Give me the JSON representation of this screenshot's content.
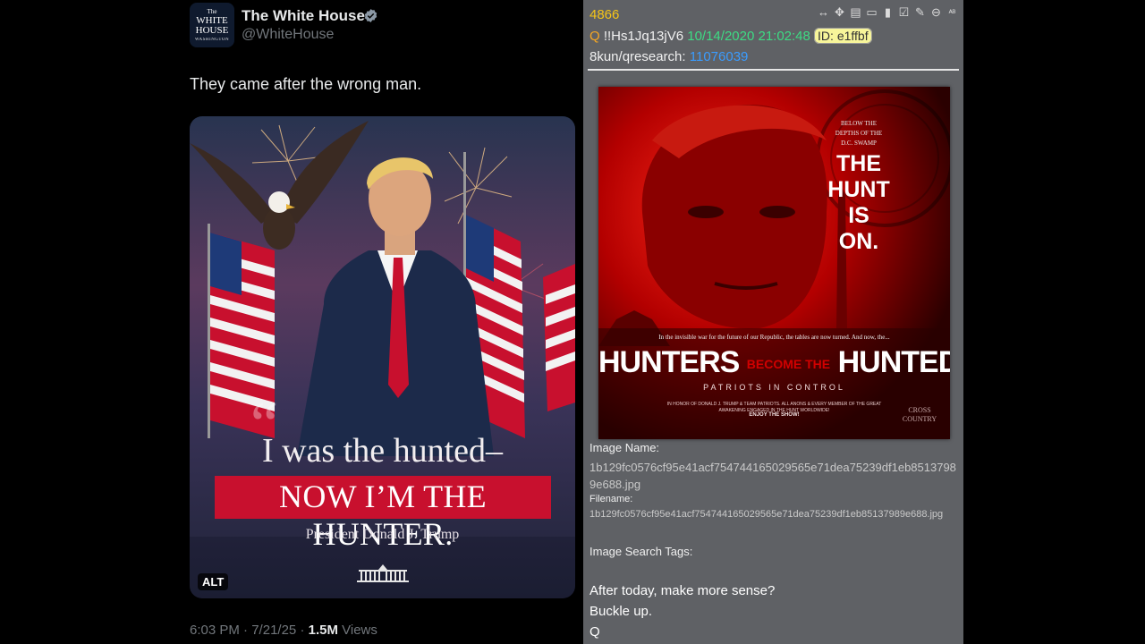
{
  "tweet": {
    "avatar_text": [
      "The",
      "WHITE\nHOUSE",
      "WASHINGTON"
    ],
    "display_name": "The White House",
    "handle": "@WhiteHouse",
    "verified": true,
    "text": "They came after the wrong man.",
    "media": {
      "quote_line1": "I was the hunted–",
      "quote_line2": "NOW I’M THE HUNTER.",
      "attribution": "President Donald J. Trump",
      "alt_label": "ALT",
      "banner_color": "#c8102e"
    },
    "meta": {
      "time": "6:03 PM",
      "date": "7/21/25",
      "views_count": "1.5M",
      "views_label": "Views"
    }
  },
  "post": {
    "number": "4866",
    "toolbar_icons": [
      "expand-icon",
      "move-icon",
      "file-icon",
      "vr-icon",
      "clipboard-icon",
      "clipboard-check-icon",
      "pin-icon",
      "arrow-up-icon",
      "translate-icon"
    ],
    "q": "Q",
    "tripcode": "!!Hs1Jq13jV6",
    "datetime": "10/14/2020 21:02:48",
    "id": "ID: e1ffbf",
    "board": "8kun/qresearch:",
    "thread_id": "11076039",
    "image": {
      "below_text": "BELOW THE\nDEPTHS OF THE\nD.C. SWAMP",
      "hunt_text": "THE\nHUNT\nIS\nON.",
      "small_text": "In the invisible war for the future of our Republic, the tables are now turned. And now, the...",
      "title_left": "HUNTERS",
      "title_mid": "BECOME THE",
      "title_right": "HUNTED",
      "subtitle": "PATRIOTS IN CONTROL",
      "honor_text": "IN HONOR OF DONALD J. TRUMP & TEAM PATRIOTS. ALL ANONS & EVERY MEMBER OF THE GREAT AWAKENING ENGAGED IN THE HUNT WORLDWIDE!",
      "enjoy": "ENJOY THE SHOW!",
      "brand": "CROSS\nCOUNTRY"
    },
    "image_name_label": "Image Name:",
    "image_name": "1b129fc0576cf95e41acf754744165029565e71dea75239df1eb85137989e688.jpg",
    "filename_label": "Filename:",
    "filename": "1b129fc0576cf95e41acf754744165029565e71dea75239df1eb85137989e688.jpg",
    "tags_label": "Image Search Tags:",
    "message": [
      "After today, make more sense?",
      "Buckle up.",
      "Q"
    ]
  }
}
